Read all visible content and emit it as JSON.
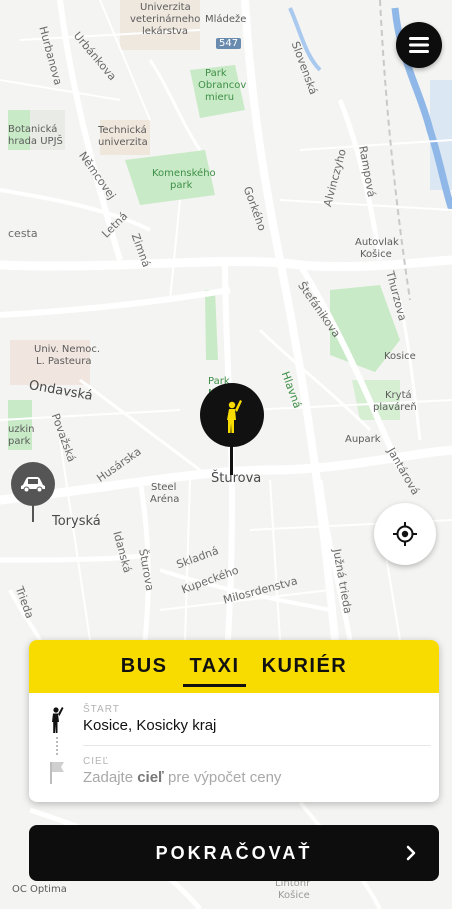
{
  "map": {
    "labels": {
      "univerzita_top": "Univerzita",
      "veterinarneho": "veterinárneho",
      "lekarstva": "lekárstva",
      "mladeze": "Mládeže",
      "road_547": "547",
      "slovenska": "Slovenská",
      "hurbanova": "Hurbanova",
      "urbankova": "Urbánkova",
      "park_obrancov_1": "Park",
      "park_obrancov_2": "Obrancov",
      "park_obrancov_3": "mieru",
      "botanicka_1": "Botanická",
      "botanicka_2": "hrada UPJŠ",
      "technicka_1": "Technická",
      "technicka_2": "univerzita",
      "nemcovej": "Němcovej",
      "komenskeho_1": "Komenského",
      "komenskeho_2": "park",
      "gorkeho": "Gorkého",
      "alvinczyho": "Alvinczyho",
      "rampova": "Rampová",
      "letna": "Letná",
      "zimna": "Zimná",
      "cesta": "cesta",
      "autovlak_1": "Autovlak",
      "autovlak_2": "Košice",
      "stefanikova": "Štefánikova",
      "thurzova": "Thurzova",
      "univ_nemoc_1": "Univ. Nemoc.",
      "univ_nemoc_2": "L. Pasteura",
      "ondavska": "Ondavská",
      "park_mo_1": "Park",
      "park_mo_2": "Mo",
      "hlavna": "Hlavná",
      "kosice_station": "Kosice",
      "kryta_1": "Krytá",
      "kryta_2": "plaváreň",
      "povazska": "Považská",
      "uzkin_1": "uzkin",
      "uzkin_2": "park",
      "husarska": "Husárska",
      "aupark": "Aupark",
      "jantarova": "Jantárová",
      "sturova_main": "Šturova",
      "steel_1": "Steel",
      "steel_2": "Aréna",
      "toryska": "Toryská",
      "sturova_vertical": "Šturova",
      "idanska": "Idanská",
      "skladna": "Skladná",
      "kupeckeho": "Kupeckého",
      "milosrdenstva": "Milosrdenstva",
      "juzna_trieda": "Južná trieda",
      "trieda": "Trieda",
      "oc_optima": "OC Optima",
      "bottom_kosice_1": "Lintonr",
      "bottom_kosice_2": "Košice"
    }
  },
  "menu": {
    "icon": "hamburger-menu-icon"
  },
  "locate": {
    "icon": "crosshair-location-icon"
  },
  "pin": {
    "icon": "hailing-person-icon"
  },
  "car": {
    "icon": "car-icon"
  },
  "panel": {
    "tabs": [
      {
        "label": "BUS",
        "active": false
      },
      {
        "label": "TAXI",
        "active": true
      },
      {
        "label": "KURIÉR",
        "active": false
      }
    ],
    "start": {
      "label": "ŠTART",
      "value": "Kosice, Kosicky kraj"
    },
    "destination": {
      "label": "CIEĽ",
      "placeholder_prefix": "Zadajte ",
      "placeholder_strong": "cieľ",
      "placeholder_suffix": " pre výpočet ceny"
    }
  },
  "continue_button": {
    "label": "POKRAČOVAŤ"
  },
  "colors": {
    "accent_yellow": "#f8dc00",
    "dark": "#0d0d0d",
    "map_bg": "#f4f4f2",
    "park_green": "#c8eac6",
    "river_blue": "#8fb8e8"
  }
}
